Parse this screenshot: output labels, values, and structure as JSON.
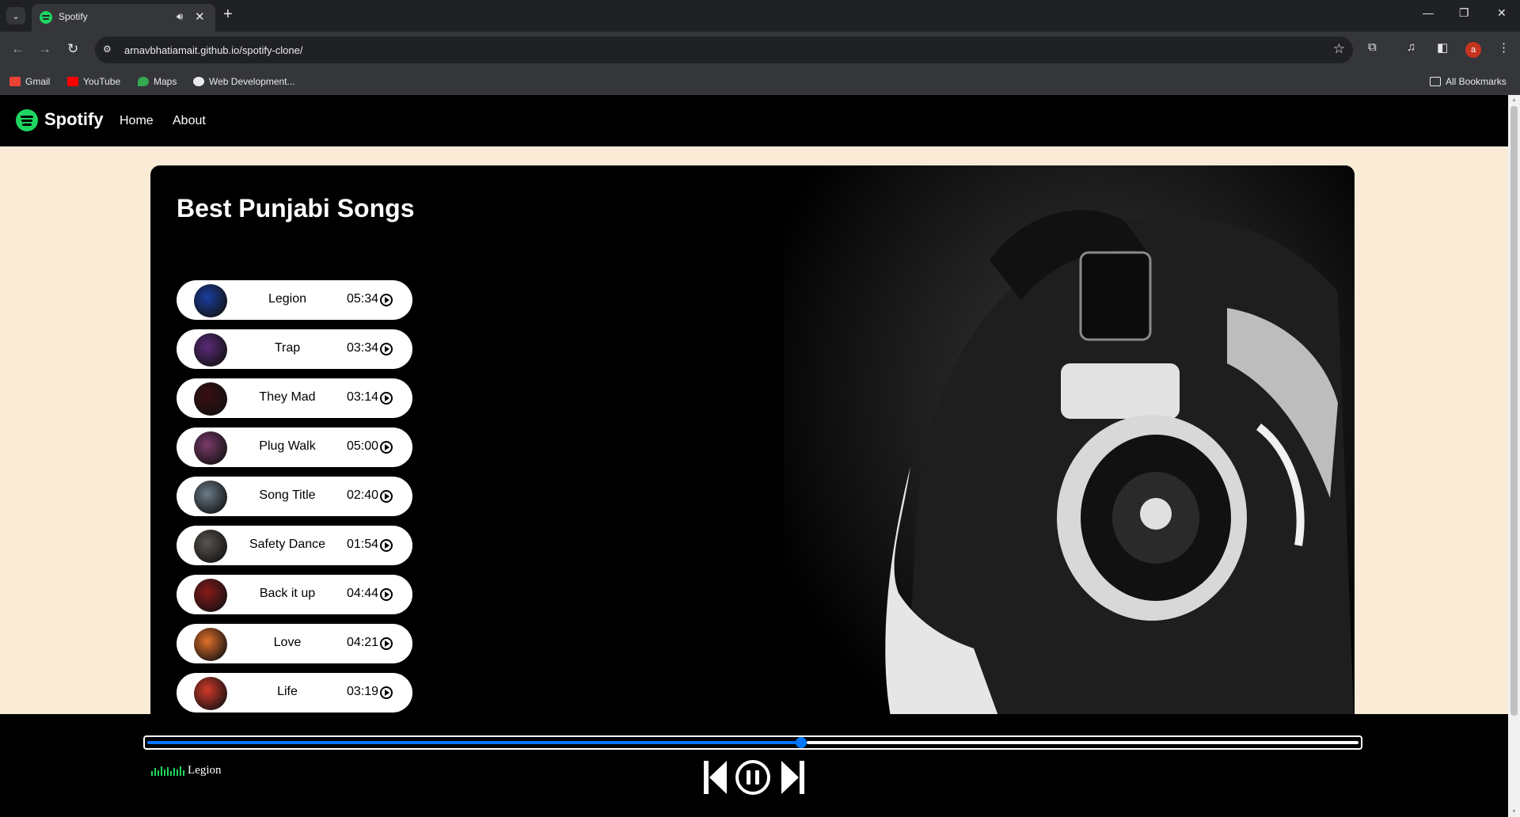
{
  "browser": {
    "tab_title": "Spotify",
    "url": "arnavbhatiamait.github.io/spotify-clone/",
    "profile_initial": "a",
    "bookmarks": [
      "Gmail",
      "YouTube",
      "Maps",
      "Web Development..."
    ],
    "all_bookmarks": "All Bookmarks"
  },
  "navbar": {
    "brand": "Spotify",
    "links": [
      "Home",
      "About"
    ]
  },
  "page_title": "Best Punjabi Songs",
  "songs": [
    {
      "name": "Legion",
      "duration": "05:34",
      "color": "#1b3fa0"
    },
    {
      "name": "Trap",
      "duration": "03:34",
      "color": "#5a2a7a"
    },
    {
      "name": "They Mad",
      "duration": "03:14",
      "color": "#3a0e12"
    },
    {
      "name": "Plug Walk",
      "duration": "05:00",
      "color": "#7a3a6a"
    },
    {
      "name": "Song Title",
      "duration": "02:40",
      "color": "#6b7c8a"
    },
    {
      "name": "Safety Dance",
      "duration": "01:54",
      "color": "#5a5550"
    },
    {
      "name": "Back it up",
      "duration": "04:44",
      "color": "#8a1a1a"
    },
    {
      "name": "Love",
      "duration": "04:21",
      "color": "#e2702a"
    },
    {
      "name": "Life",
      "duration": "03:19",
      "color": "#d23a2a"
    }
  ],
  "player": {
    "now_playing": "Legion",
    "progress": 0.54
  }
}
